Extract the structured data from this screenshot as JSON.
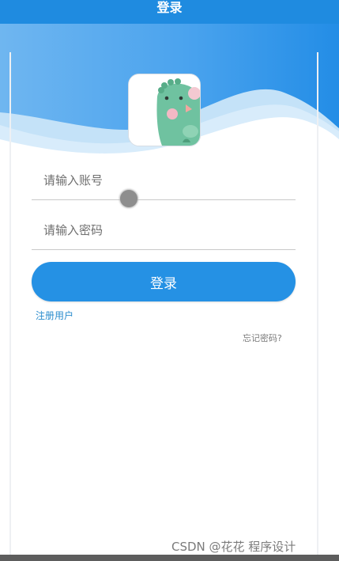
{
  "header": {
    "title": "登录"
  },
  "login_form": {
    "account_placeholder": "请输入账号",
    "password_placeholder": "请输入密码",
    "login_button": "登录",
    "register_link": "注册用户",
    "forgot_link": "忘记密码?"
  },
  "avatar": {
    "icon": "green-dinosaur-icon"
  },
  "watermark": {
    "text": "CSDN @花花 程序设计"
  },
  "colors": {
    "primary": "#2591e4",
    "header": "#1f8be0",
    "link": "#2a8ccd",
    "avatar_green": "#6fc2a0"
  }
}
